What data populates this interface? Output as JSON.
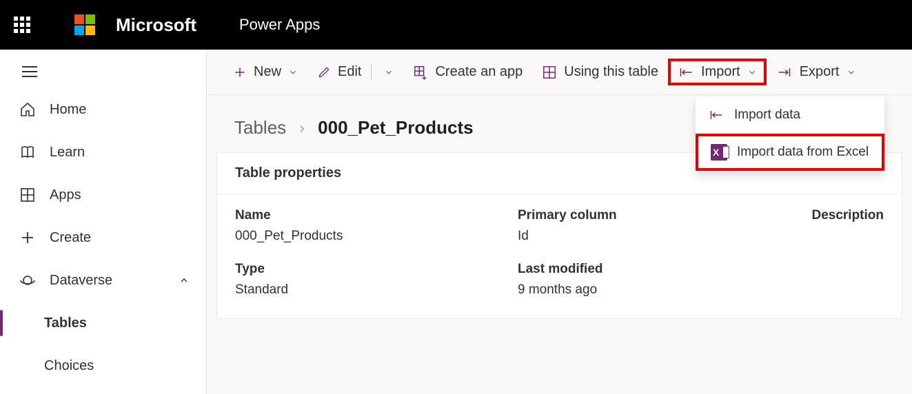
{
  "header": {
    "brand": "Microsoft",
    "app": "Power Apps"
  },
  "sidebar": {
    "home": "Home",
    "learn": "Learn",
    "apps": "Apps",
    "create": "Create",
    "dataverse": "Dataverse",
    "tables": "Tables",
    "choices": "Choices"
  },
  "toolbar": {
    "new": "New",
    "edit": "Edit",
    "create_app": "Create an app",
    "using_table": "Using this table",
    "import": "Import",
    "export": "Export"
  },
  "dropdown": {
    "import_data": "Import data",
    "import_excel": "Import data from Excel"
  },
  "breadcrumb": {
    "root": "Tables",
    "current": "000_Pet_Products"
  },
  "card": {
    "title": "Table properties",
    "labels": {
      "name": "Name",
      "type": "Type",
      "primary_column": "Primary column",
      "last_modified": "Last modified",
      "description": "Description"
    },
    "values": {
      "name": "000_Pet_Products",
      "type": "Standard",
      "primary_column": "Id",
      "last_modified": "9 months ago",
      "description": ""
    }
  }
}
